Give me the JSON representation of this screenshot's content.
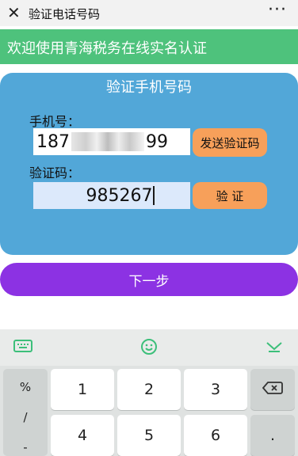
{
  "topbar": {
    "close_icon": "close-icon",
    "title": "验证电话号码",
    "more_label": "···"
  },
  "banner": {
    "text": "欢迎使用青海税务在线实名认证"
  },
  "card": {
    "heading": "验证手机号码⁠",
    "phone_label": "手机号：",
    "phone_prefix": "187",
    "phone_suffix": "99",
    "code_label": "验证码：",
    "code_value": "985267",
    "send_button": "发送验证码",
    "verify_button": "验 证"
  },
  "next_button": "下一步",
  "keyboard": {
    "toolbar_icons": [
      "keyboard-icon",
      "emoji-icon",
      "collapse-icon"
    ],
    "symbols": [
      "%",
      "/",
      "-"
    ],
    "keys_row1": [
      "1",
      "2",
      "3"
    ],
    "keys_row2": [
      "4",
      "5",
      "6"
    ],
    "extra_row2": "."
  },
  "colors": {
    "banner": "#4ec27c",
    "card": "#52a7d8",
    "orange_button": "#f7a05a",
    "next_button": "#8c32e3",
    "toolbar_icon": "#3cbf7a"
  }
}
